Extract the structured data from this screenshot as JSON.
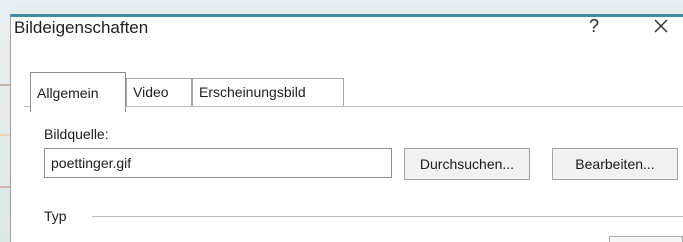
{
  "window": {
    "title": "Bildeigenschaften",
    "help_symbol": "?",
    "accent_color": "#3f8ea3"
  },
  "tabs": [
    {
      "label": "Allgemein",
      "active": true
    },
    {
      "label": "Video",
      "active": false
    },
    {
      "label": "Erscheinungsbild",
      "active": false
    }
  ],
  "source": {
    "label": "Bildquelle:",
    "value": "poettinger.gif",
    "browse_label": "Durchsuchen...",
    "edit_label": "Bearbeiten..."
  },
  "type_group": {
    "label": "Typ"
  }
}
